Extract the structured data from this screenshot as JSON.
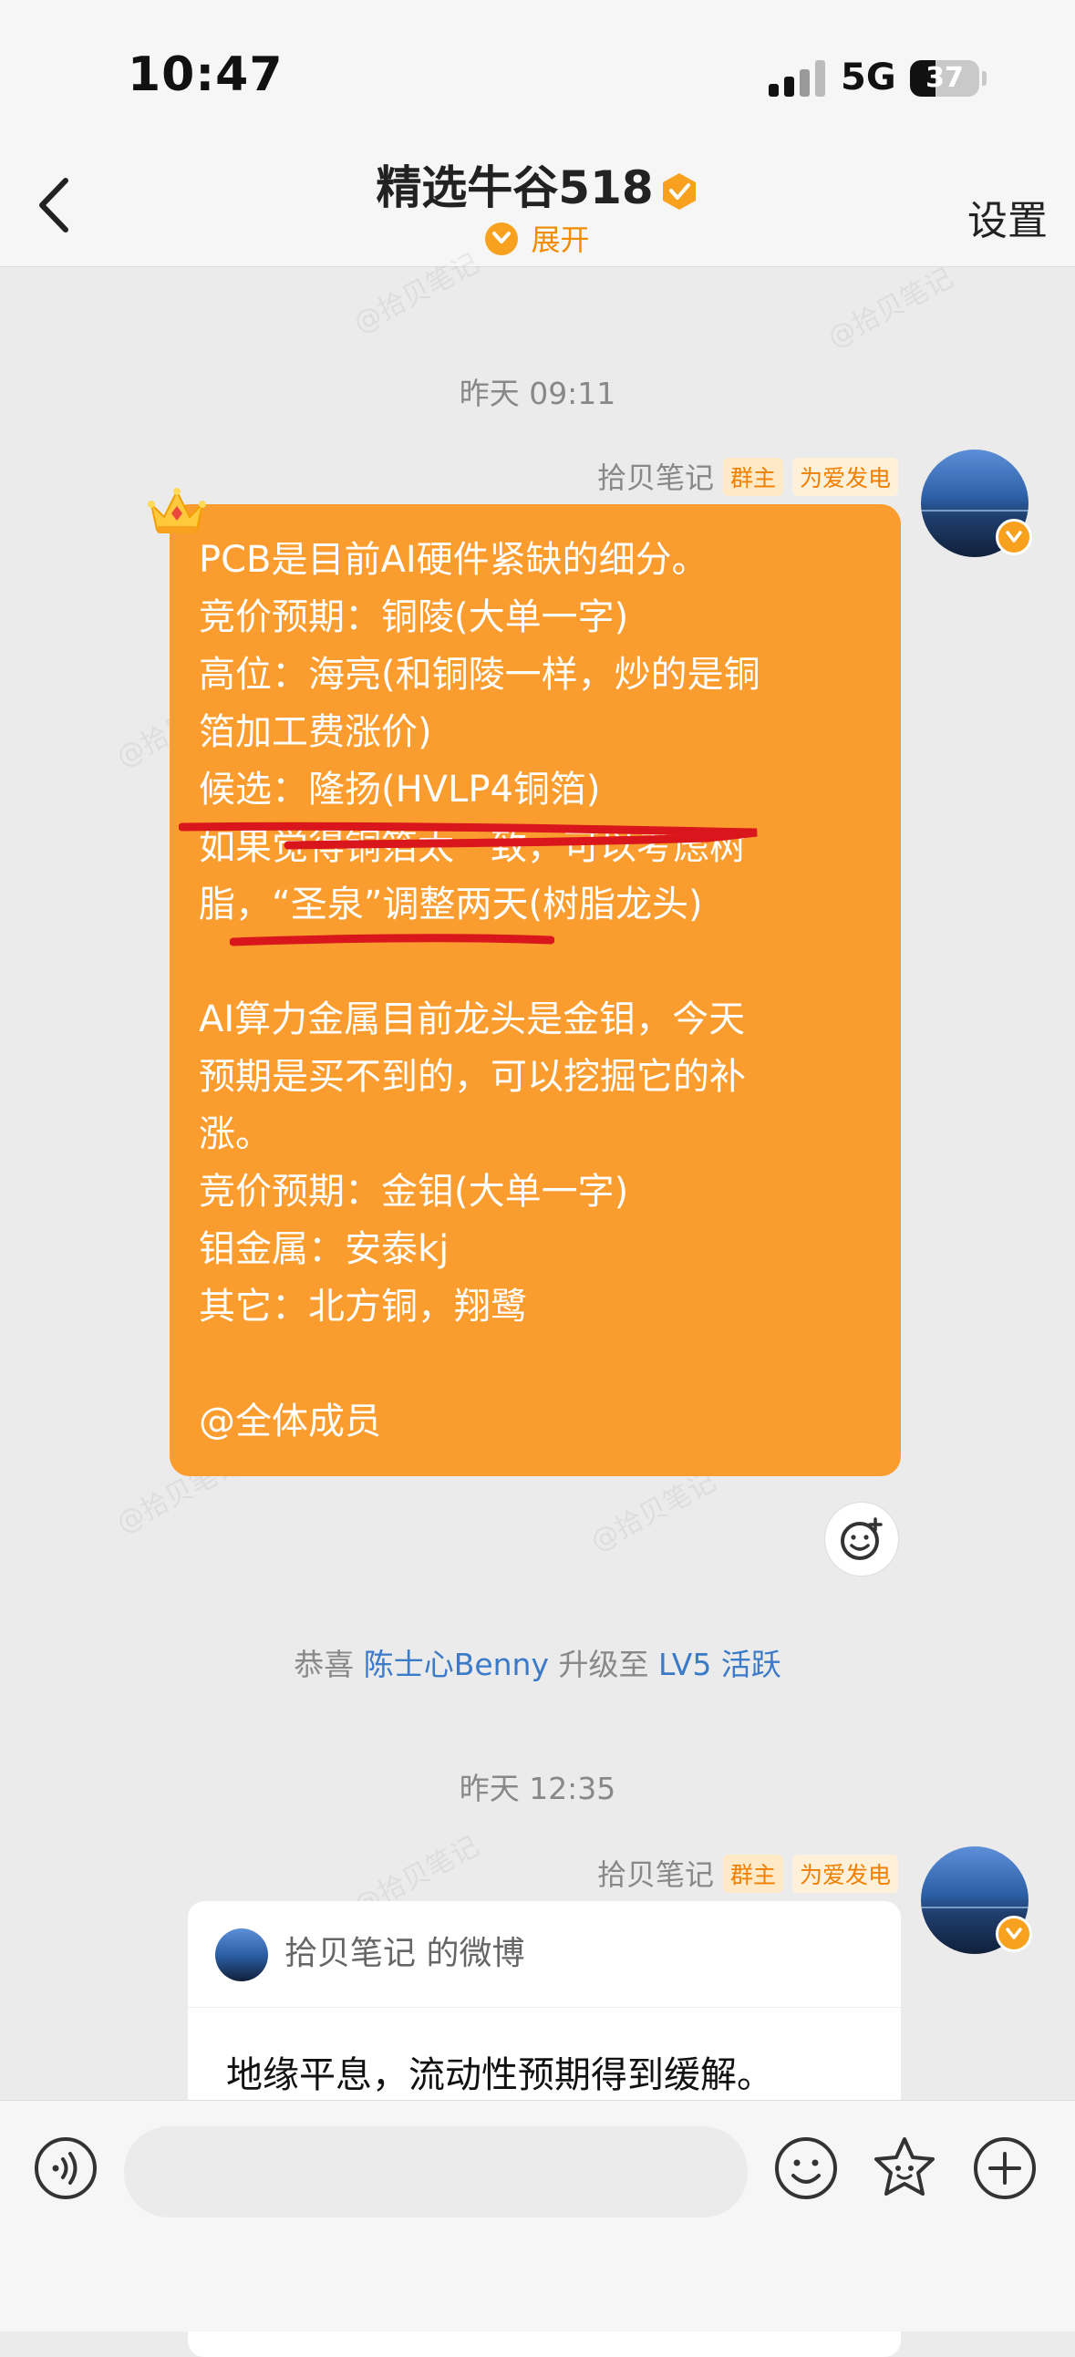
{
  "status_bar": {
    "time": "10:47",
    "network": "5G",
    "battery": "37"
  },
  "nav": {
    "title": "精选牛谷518",
    "expand_label": "展开",
    "settings_label": "设置"
  },
  "messages": [
    {
      "timestamp": "昨天 09:11",
      "sender": "拾贝笔记",
      "tags": [
        "群主",
        "为爱发电"
      ],
      "text": "PCB是目前AI硬件紧缺的细分。\n竞价预期：铜陵(大单一字)\n高位：海亮(和铜陵一样，炒的是铜\n箔加工费涨价)\n候选：隆扬(HVLP4铜箔)\n如果觉得铜箔太一致，可以考虑树\n脂，“圣泉”调整两天(树脂龙头)\n\nAI算力金属目前龙头是金钼，今天\n预期是买不到的，可以挖掘它的补\n涨。\n竞价预期：金钼(大单一字)\n钼金属：安泰kj\n其它：北方铜，翔鹭\n\n@全体成员"
    },
    {
      "timestamp": "昨天 12:35",
      "sender": "拾贝笔记",
      "tags": [
        "群主",
        "为爱发电"
      ],
      "card_source": "拾贝笔记 的微博",
      "card_text": "地缘平息，流动性预期得到缓解。"
    }
  ],
  "system_notice": {
    "prefix": "恭喜 ",
    "name": "陈士心Benny",
    "middle": " 升级至 ",
    "level": "LV5 活跃"
  },
  "watermark": "@拾贝笔记",
  "input": {
    "placeholder": ""
  }
}
